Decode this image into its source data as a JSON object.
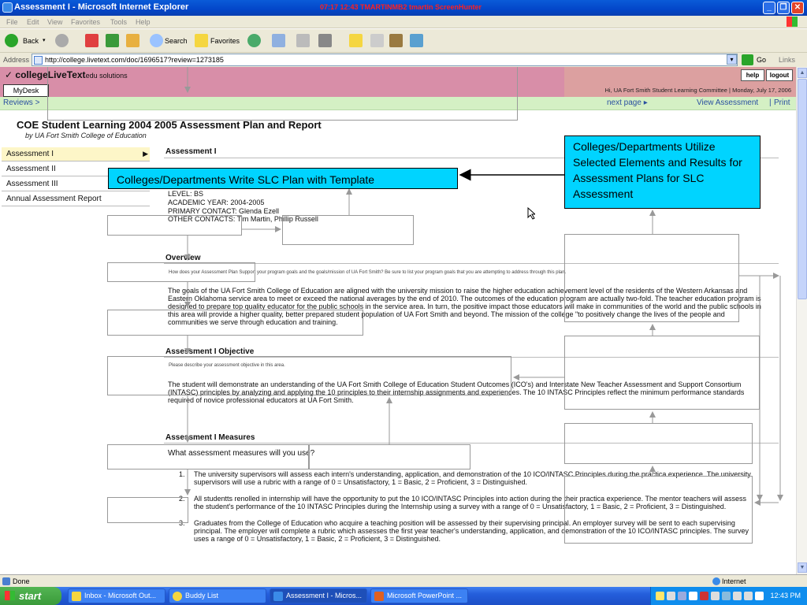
{
  "window": {
    "title": "Assessment I - Microsoft Internet Explorer",
    "overlay_text": "07:17  12:43  TMARTINMB2  tmartin  ScreenHunter",
    "controls": [
      "minimize",
      "restore",
      "close"
    ]
  },
  "menu": [
    "File",
    "Edit",
    "View",
    "Favorites",
    "Tools",
    "Help"
  ],
  "toolbar": {
    "back": "Back",
    "search": "Search",
    "favorites": "Favorites"
  },
  "address": {
    "label": "Address",
    "url": "http://college.livetext.com/doc/1696517?review=1273185",
    "go": "Go",
    "links": "Links"
  },
  "site": {
    "logo_main": "collegeLiveText",
    "logo_suffix": "edu solutions",
    "mydesk": "MyDesk",
    "help": "help",
    "logout": "logout",
    "welcome": "Hi, UA Fort Smith Student Learning Committee  |   Monday, July 17, 2006"
  },
  "nav": {
    "reviews": "Reviews >",
    "next_page": "next page ▸",
    "view_assessment": "View Assessment",
    "separator": "|",
    "print": "Print"
  },
  "document": {
    "title": "COE Student Learning 2004 2005 Assessment Plan and Report",
    "subtitle": "by UA Fort Smith College of Education"
  },
  "sidebar": {
    "items": [
      {
        "label": "Assessment I",
        "active": true
      },
      {
        "label": "Assessment II",
        "active": false
      },
      {
        "label": "Assessment III",
        "active": false
      },
      {
        "label": "Annual Assessment Report",
        "active": false
      }
    ]
  },
  "content": {
    "section_header": "Assessment I",
    "meta": {
      "level": "LEVEL: BS",
      "year": "ACADEMIC YEAR: 2004-2005",
      "primary": "PRIMARY CONTACT: Glenda Ezell",
      "other": "OTHER CONTACTS: Tim Martin, Phillip Russell"
    },
    "overview": {
      "heading": "Overview",
      "question": "How does your Assessment Plan Support your program goals and the goals/mission of UA Fort Smith?   Be sure to list your program goals that you are attempting to address through this plan.",
      "text": "The goals of the UA Fort Smith College of Education are aligned with the university mission to raise the higher education achievement level of the residents of the Western Arkansas and Eastern Oklahoma service area to meet or exceed the national averages by the end of 2010. The outcomes of the education program are actually two-fold. The teacher education program is designed to prepare top quality educator for the public schools in the service area. In turn, the positive impact those educators will make in communities of the world and the public schools in this area will provide a higher quality, better prepared student population of UA Fort Smith and beyond. The mission of the college \"to positively change the lives of the people and communities we serve through education and training."
    },
    "objective": {
      "heading": "Assessment I Objective",
      "question": "Please describe your assessment objective in this area.",
      "text": "The student will demonstrate an understanding of the UA Fort Smith College of Education Student Outcomes (ICO's) and Interstate New Teacher Assessment and Support Consortium (INTASC) principles by analyzing and applying the 10 principles to their internship assignments and experiences. The 10 INTASC Principles reflect the minimum performance standards required of novice professional educators at UA Fort Smith."
    },
    "measures": {
      "heading": "Assessment I Measures",
      "question": "What assessment measures will you use?",
      "items": [
        {
          "n": "1.",
          "text": "The university supervisors will assess each intern's understanding, application, and demonstration of the 10 ICO/INTASC Principles during the practica experience. The university supervisors will use a rubric with a range of 0 = Unsatisfactory, 1 = Basic, 2 = Proficient, 3 = Distinguished."
        },
        {
          "n": "2.",
          "text": "All studentts renolled in internship will have the opportunity to put the 10 ICO/INTASC Principles into action during the their practica experience.  The mentor teachers will assess the student's performance of the 10 INTASC Principles during the Internship using a survey with a range of 0 = Unsatisfactory, 1 = Basic, 2 = Proficient, 3 = Distinguished."
        },
        {
          "n": "3.",
          "text": "Graduates from the College of Education who acquire a teaching position will be assessed by their supervising principal.  An employer survey will be sent to each supervising principal.  The employer will complete a rubric which assesses the first year teacher's understanding, application, and demonstration of the 10 ICO/INTASC principles.  The survey uses a range of 0 = Unsatisfactory, 1 = Basic, 2 = Proficient, 3 = Distinguished."
        }
      ]
    }
  },
  "callouts": {
    "left": "Colleges/Departments Write SLC Plan with Template",
    "right": "Colleges/Departments Utilize Selected Elements and Results for Assessment Plans for SLC  Assessment"
  },
  "status": {
    "left": "Done",
    "right": "Internet"
  },
  "taskbar": {
    "start": "start",
    "tasks": [
      "Inbox - Microsoft Out...",
      "Buddy List",
      "Assessment I - Micros...",
      "Microsoft PowerPoint ..."
    ],
    "clock": "12:43 PM"
  },
  "colors": {
    "header_pink": "#d88ea8",
    "nav_green": "#d4f0c4",
    "callout_cyan": "#00d4ff",
    "titlebar_blue": "#0346c9"
  }
}
